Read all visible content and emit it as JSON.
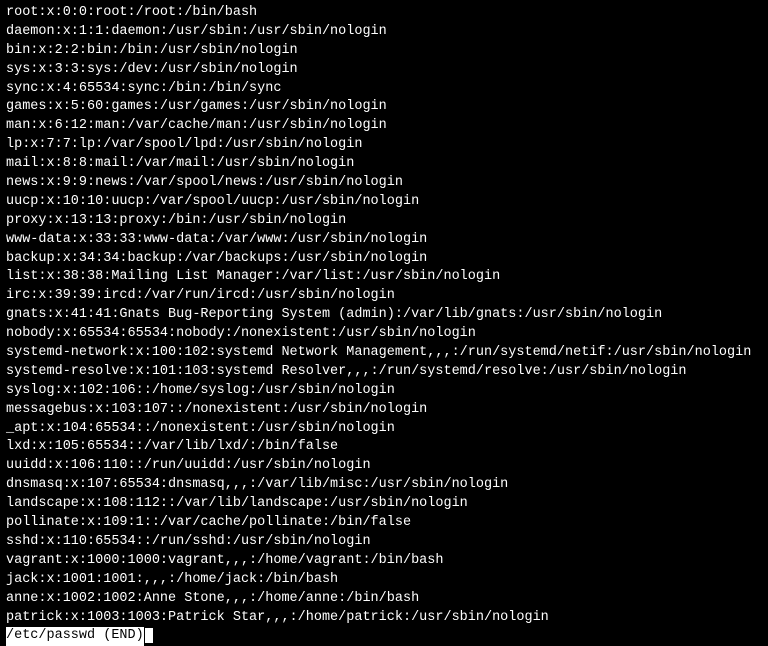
{
  "passwd_entries": [
    "root:x:0:0:root:/root:/bin/bash",
    "daemon:x:1:1:daemon:/usr/sbin:/usr/sbin/nologin",
    "bin:x:2:2:bin:/bin:/usr/sbin/nologin",
    "sys:x:3:3:sys:/dev:/usr/sbin/nologin",
    "sync:x:4:65534:sync:/bin:/bin/sync",
    "games:x:5:60:games:/usr/games:/usr/sbin/nologin",
    "man:x:6:12:man:/var/cache/man:/usr/sbin/nologin",
    "lp:x:7:7:lp:/var/spool/lpd:/usr/sbin/nologin",
    "mail:x:8:8:mail:/var/mail:/usr/sbin/nologin",
    "news:x:9:9:news:/var/spool/news:/usr/sbin/nologin",
    "uucp:x:10:10:uucp:/var/spool/uucp:/usr/sbin/nologin",
    "proxy:x:13:13:proxy:/bin:/usr/sbin/nologin",
    "www-data:x:33:33:www-data:/var/www:/usr/sbin/nologin",
    "backup:x:34:34:backup:/var/backups:/usr/sbin/nologin",
    "list:x:38:38:Mailing List Manager:/var/list:/usr/sbin/nologin",
    "irc:x:39:39:ircd:/var/run/ircd:/usr/sbin/nologin",
    "gnats:x:41:41:Gnats Bug-Reporting System (admin):/var/lib/gnats:/usr/sbin/nologin",
    "nobody:x:65534:65534:nobody:/nonexistent:/usr/sbin/nologin",
    "systemd-network:x:100:102:systemd Network Management,,,:/run/systemd/netif:/usr/sbin/nologin",
    "systemd-resolve:x:101:103:systemd Resolver,,,:/run/systemd/resolve:/usr/sbin/nologin",
    "syslog:x:102:106::/home/syslog:/usr/sbin/nologin",
    "messagebus:x:103:107::/nonexistent:/usr/sbin/nologin",
    "_apt:x:104:65534::/nonexistent:/usr/sbin/nologin",
    "lxd:x:105:65534::/var/lib/lxd/:/bin/false",
    "uuidd:x:106:110::/run/uuidd:/usr/sbin/nologin",
    "dnsmasq:x:107:65534:dnsmasq,,,:/var/lib/misc:/usr/sbin/nologin",
    "landscape:x:108:112::/var/lib/landscape:/usr/sbin/nologin",
    "pollinate:x:109:1::/var/cache/pollinate:/bin/false",
    "sshd:x:110:65534::/run/sshd:/usr/sbin/nologin",
    "vagrant:x:1000:1000:vagrant,,,:/home/vagrant:/bin/bash",
    "jack:x:1001:1001:,,,:/home/jack:/bin/bash",
    "anne:x:1002:1002:Anne Stone,,,:/home/anne:/bin/bash",
    "patrick:x:1003:1003:Patrick Star,,,:/home/patrick:/usr/sbin/nologin"
  ],
  "status_line": "/etc/passwd (END)"
}
